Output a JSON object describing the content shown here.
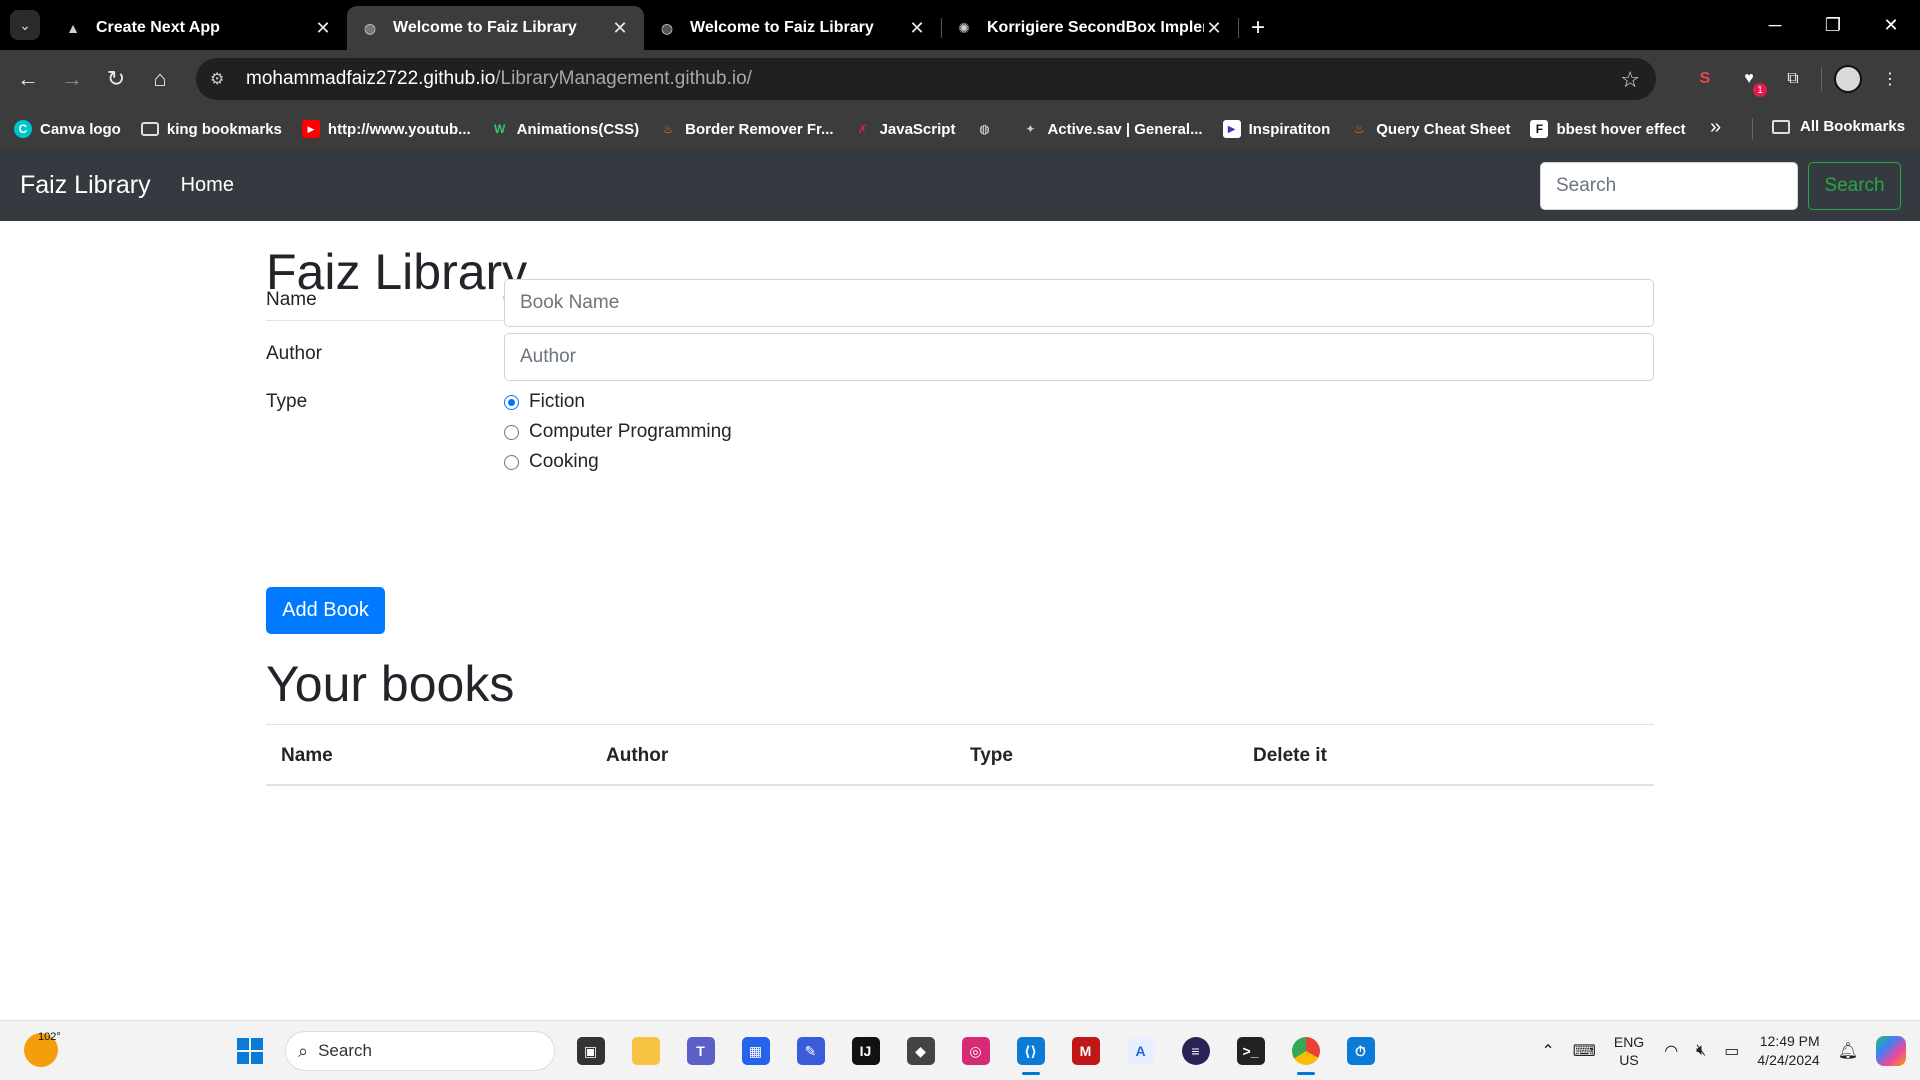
{
  "browser": {
    "tabs": [
      {
        "title": "Create Next App",
        "icon": "triangle-icon",
        "active": false
      },
      {
        "title": "Welcome to Faiz Library",
        "icon": "globe-icon",
        "active": true
      },
      {
        "title": "Welcome to Faiz Library",
        "icon": "globe-icon",
        "active": false
      },
      {
        "title": "Korrigiere SecondBox Impleme",
        "icon": "chatgpt-icon",
        "active": false
      }
    ],
    "url_host": "mohammadfaiz2722.github.io",
    "url_path": "/LibraryManagement.github.io/",
    "extension_badge": "1",
    "bookmarks": [
      {
        "label": "Canva logo",
        "icon": "canva-icon"
      },
      {
        "label": "king bookmarks",
        "icon": "folder-icon"
      },
      {
        "label": "http://www.youtub...",
        "icon": "youtube-icon"
      },
      {
        "label": "Animations(CSS)",
        "icon": "w-icon"
      },
      {
        "label": "Border Remover Fr...",
        "icon": "bottle-icon"
      },
      {
        "label": "JavaScript",
        "icon": "js-icon"
      },
      {
        "label": "",
        "icon": "globe-icon"
      },
      {
        "label": "Active.sav | General...",
        "icon": "cat-icon"
      },
      {
        "label": "Inspiratiton",
        "icon": "play-icon"
      },
      {
        "label": "Query Cheat Sheet",
        "icon": "bottle-icon"
      },
      {
        "label": "bbest hover effect",
        "icon": "f-icon"
      }
    ],
    "all_bookmarks_label": "All Bookmarks"
  },
  "navbar": {
    "brand": "Faiz Library",
    "home": "Home",
    "search_placeholder": "Search",
    "search_button": "Search"
  },
  "form": {
    "heading": "Faiz Library",
    "name_label": "Name",
    "name_placeholder": "Book Name",
    "author_label": "Author",
    "author_placeholder": "Author",
    "type_label": "Type",
    "types": [
      {
        "label": "Fiction",
        "checked": true
      },
      {
        "label": "Computer Programming",
        "checked": false
      },
      {
        "label": "Cooking",
        "checked": false
      }
    ],
    "add_button": "Add Book"
  },
  "books": {
    "heading": "Your books",
    "columns": [
      "Name",
      "Author",
      "Type",
      "Delete it"
    ]
  },
  "taskbar": {
    "weather_temp": "102°",
    "search_label": "Search",
    "lang_line1": "ENG",
    "lang_line2": "US",
    "time": "12:49 PM",
    "date": "4/24/2024"
  },
  "colors": {
    "navbar_bg": "#343a40",
    "primary_button": "#007bff",
    "search_outline": "#28a745",
    "radio_accent": "#0075ff"
  }
}
